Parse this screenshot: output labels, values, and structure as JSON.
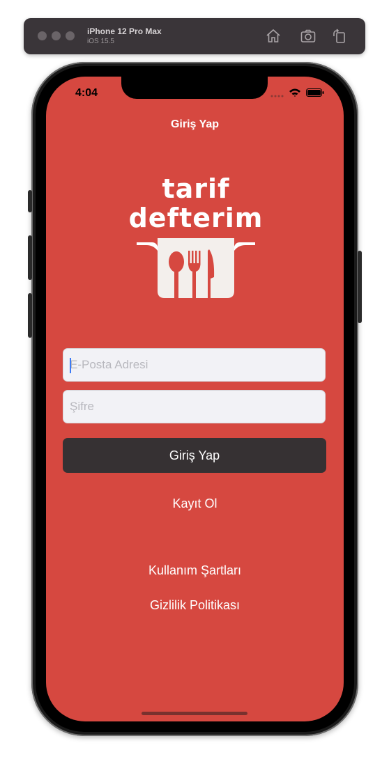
{
  "simulator": {
    "device_name": "iPhone 12 Pro Max",
    "os_version": "iOS 15.5",
    "icons": [
      "home-icon",
      "screenshot-icon",
      "rotate-icon"
    ]
  },
  "status_bar": {
    "time": "4:04"
  },
  "nav": {
    "title": "Giriş Yap"
  },
  "logo": {
    "line1": "tarif",
    "line2": "defterim"
  },
  "form": {
    "email_placeholder": "E-Posta Adresi",
    "email_value": "",
    "password_placeholder": "Şifre",
    "password_value": "",
    "login_label": "Giriş Yap"
  },
  "links": {
    "register": "Kayıt Ol",
    "terms": "Kullanım Şartları",
    "privacy": "Gizlilik Politikası"
  },
  "colors": {
    "background": "#d64840",
    "button": "#363133",
    "field": "#f2f2f6",
    "text": "#ffffff"
  }
}
